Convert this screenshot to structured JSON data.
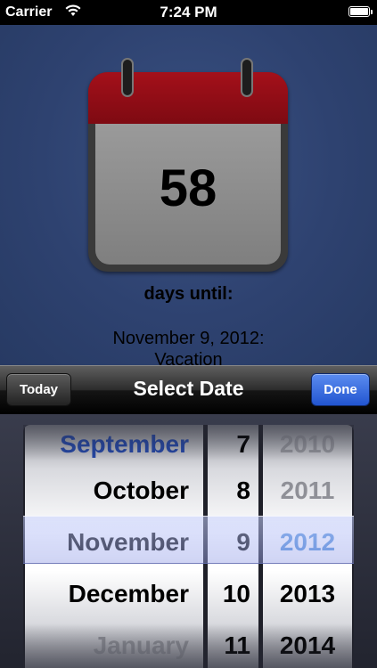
{
  "status_bar": {
    "carrier": "Carrier",
    "time": "7:24 PM",
    "wifi_icon": "wifi-icon",
    "battery_icon": "battery-icon",
    "battery_level": 1.0
  },
  "countdown": {
    "days": "58",
    "label": "days until:",
    "event_date": "November 9, 2012:",
    "event_name": "Vacation"
  },
  "toolbar": {
    "today_label": "Today",
    "title": "Select Date",
    "done_label": "Done"
  },
  "picker": {
    "months": [
      "September",
      "October",
      "November",
      "December",
      "January"
    ],
    "days": [
      "7",
      "8",
      "9",
      "10",
      "11"
    ],
    "years": [
      "2010",
      "2011",
      "2012",
      "2013",
      "2014"
    ],
    "selected": {
      "month": "November",
      "day": "9",
      "year": "2012"
    },
    "selection_color": "#4d8cd8"
  }
}
